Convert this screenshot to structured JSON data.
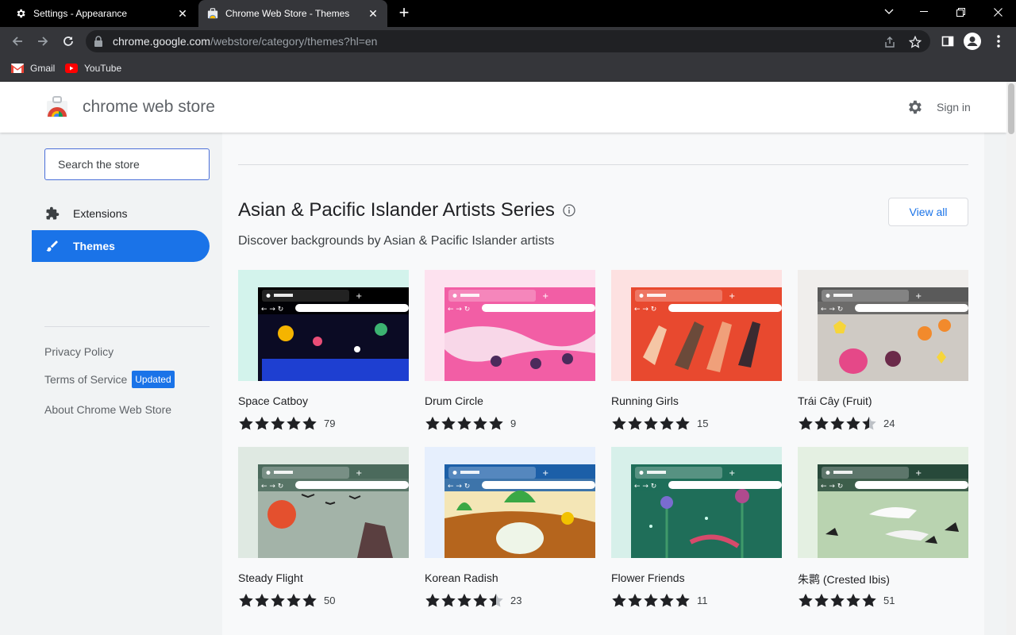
{
  "browser": {
    "tabs": [
      {
        "title": "Settings - Appearance",
        "icon": "gear-icon",
        "active": false
      },
      {
        "title": "Chrome Web Store - Themes",
        "icon": "webstore-icon",
        "active": true
      }
    ],
    "url": {
      "host": "chrome.google.com",
      "path": "/webstore/category/themes?hl=en"
    },
    "bookmarks": [
      {
        "label": "Gmail",
        "icon": "gmail-icon"
      },
      {
        "label": "YouTube",
        "icon": "youtube-icon"
      }
    ]
  },
  "store": {
    "title": "chrome web store",
    "sign_in": "Sign in",
    "search_placeholder": "Search the store",
    "nav": [
      {
        "label": "Extensions",
        "icon": "puzzle-icon",
        "active": false
      },
      {
        "label": "Themes",
        "icon": "brush-icon",
        "active": true
      }
    ],
    "links": {
      "privacy": "Privacy Policy",
      "terms": "Terms of Service",
      "terms_badge": "Updated",
      "about": "About Chrome Web Store"
    }
  },
  "collection": {
    "title": "Asian & Pacific Islander Artists Series",
    "subtitle": "Discover backgrounds by Asian & Pacific Islander artists",
    "view_all": "View all",
    "themes": [
      {
        "name": "Space Catboy",
        "rating": 5,
        "count": "79",
        "accent": "#000000"
      },
      {
        "name": "Drum Circle",
        "rating": 5,
        "count": "9",
        "accent": "#f25ea5"
      },
      {
        "name": "Running Girls",
        "rating": 5,
        "count": "15",
        "accent": "#e8492f"
      },
      {
        "name": "Trái Cây (Fruit)",
        "rating": 4.5,
        "count": "24",
        "accent": "#5a5a5a"
      },
      {
        "name": "Steady Flight",
        "rating": 5,
        "count": "50",
        "accent": "#4b6a5c"
      },
      {
        "name": "Korean Radish",
        "rating": 4.5,
        "count": "23",
        "accent": "#1c5fa8"
      },
      {
        "name": "Flower Friends",
        "rating": 5,
        "count": "11",
        "accent": "#1f6e59"
      },
      {
        "name": "朱鹮 (Crested Ibis)",
        "rating": 5,
        "count": "51",
        "accent": "#27493a"
      }
    ]
  }
}
